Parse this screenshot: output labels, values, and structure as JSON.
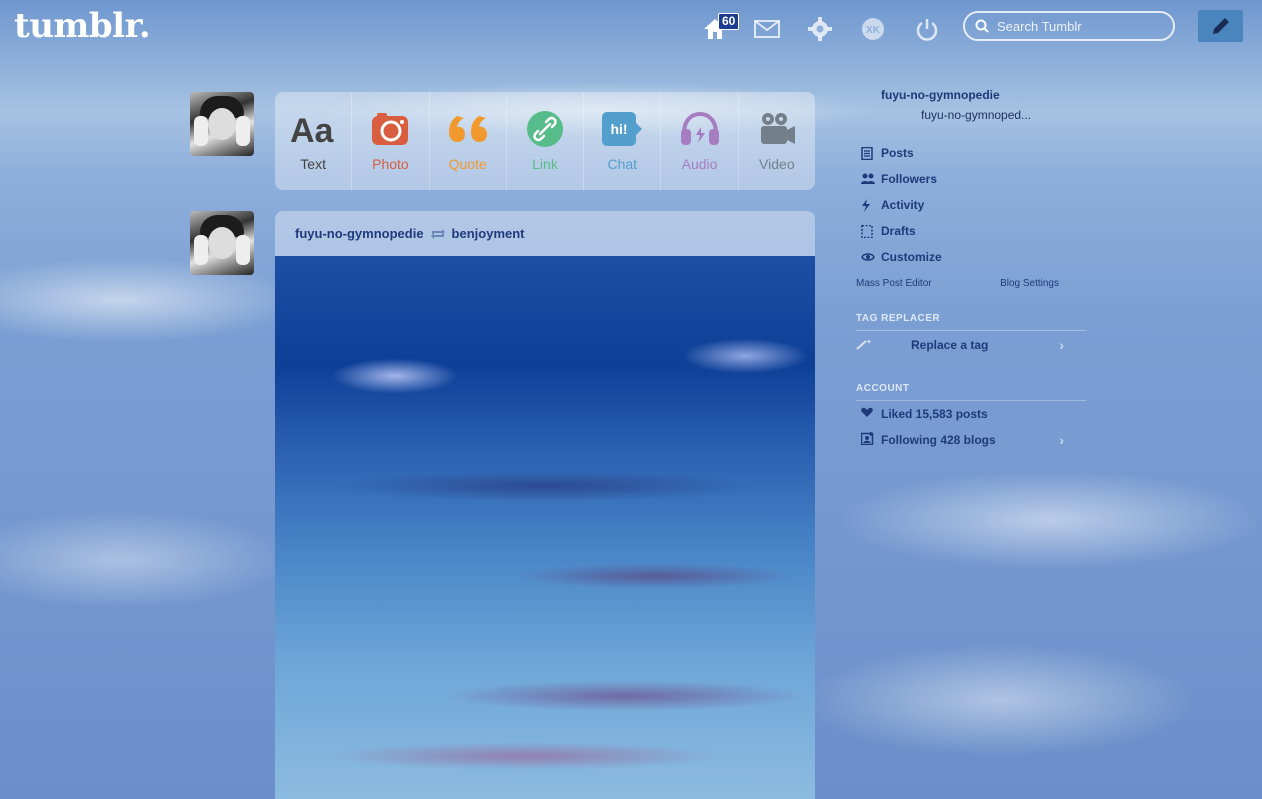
{
  "header": {
    "logo": "tumblr.",
    "inbox_count": "60",
    "search_placeholder": "Search Tumblr"
  },
  "post_types": [
    {
      "label": "Text",
      "color": "#444444",
      "icon": "text-icon"
    },
    {
      "label": "Photo",
      "color": "#d95e40",
      "icon": "camera-icon"
    },
    {
      "label": "Quote",
      "color": "#f2992e",
      "icon": "quote-icon"
    },
    {
      "label": "Link",
      "color": "#56bc8a",
      "icon": "link-icon"
    },
    {
      "label": "Chat",
      "color": "#529ecc",
      "icon": "chat-icon"
    },
    {
      "label": "Audio",
      "color": "#a77dc2",
      "icon": "headphones-icon"
    },
    {
      "label": "Video",
      "color": "#748089",
      "icon": "video-camera-icon"
    }
  ],
  "post": {
    "author": "fuyu-no-gymnopedie",
    "reblogged_from": "benjoyment"
  },
  "sidebar": {
    "blog_name": "fuyu-no-gymnopedie",
    "blog_title": "fuyu-no-gymnoped...",
    "items": [
      {
        "label": "Posts",
        "icon": "posts-icon"
      },
      {
        "label": "Followers",
        "icon": "followers-icon"
      },
      {
        "label": "Activity",
        "icon": "lightning-icon"
      },
      {
        "label": "Drafts",
        "icon": "drafts-icon"
      },
      {
        "label": "Customize",
        "icon": "eye-icon"
      }
    ],
    "mass_post_editor": "Mass Post Editor",
    "blog_settings": "Blog Settings",
    "tag_replacer_heading": "TAG REPLACER",
    "replace_tag": "Replace a tag",
    "account_heading": "ACCOUNT",
    "liked": "Liked 15,583 posts",
    "following": "Following 428 blogs"
  }
}
